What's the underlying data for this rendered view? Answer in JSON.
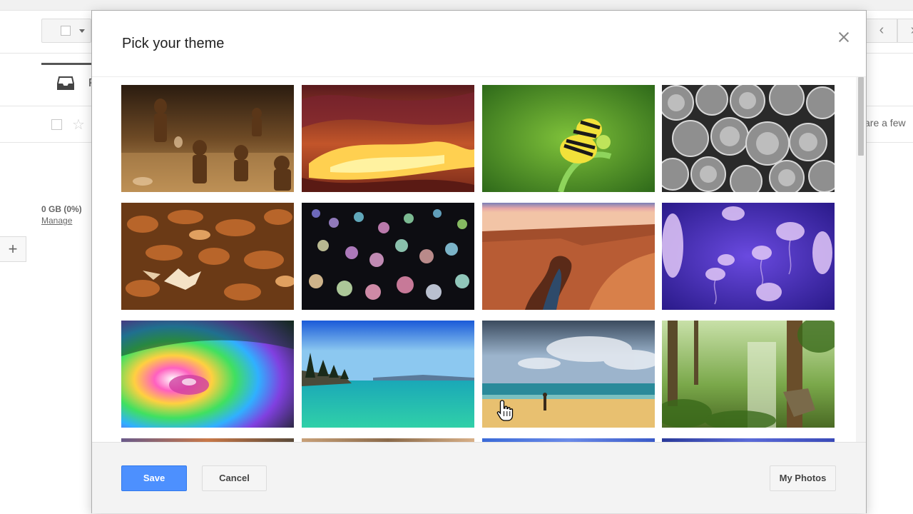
{
  "background": {
    "tab_letter": "P",
    "storage_text": "0 GB (0%)",
    "manage_link": "Manage",
    "add_label": "+",
    "preview_text": "are a few"
  },
  "dialog": {
    "title": "Pick your theme",
    "close_icon": "close-icon",
    "themes": [
      {
        "name": "theme-chess"
      },
      {
        "name": "theme-canyon-slot"
      },
      {
        "name": "theme-caterpillar"
      },
      {
        "name": "theme-pipes"
      },
      {
        "name": "theme-autumn-leaves"
      },
      {
        "name": "theme-bokeh-lights"
      },
      {
        "name": "theme-grand-canyon"
      },
      {
        "name": "theme-jellyfish"
      },
      {
        "name": "theme-rainbow-droplet"
      },
      {
        "name": "theme-lake-tahoe"
      },
      {
        "name": "theme-beach"
      },
      {
        "name": "theme-forest"
      }
    ],
    "buttons": {
      "save": "Save",
      "cancel": "Cancel",
      "my_photos": "My Photos"
    }
  },
  "colors": {
    "save_button": "#4d90fe",
    "dialog_background": "#ffffff",
    "footer_background": "#f3f3f3"
  }
}
